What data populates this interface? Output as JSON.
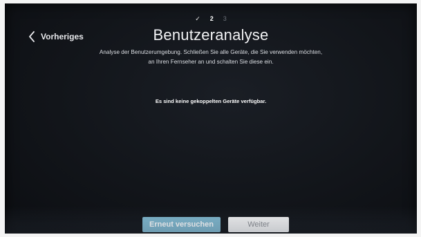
{
  "steps": {
    "step1": "✓",
    "step2": "2",
    "step3": "3"
  },
  "header": {
    "back_label": "Vorheriges",
    "title": "Benutzeranalyse"
  },
  "description": {
    "line1": "Analyse der Benutzerumgebung. Schließen Sie alle Geräte, die Sie verwenden möchten,",
    "line2": "an Ihren Fernseher an und schalten Sie diese ein."
  },
  "status_message": "Es sind keine gekoppelten Geräte verfügbar.",
  "buttons": {
    "retry_label": "Erneut versuchen",
    "next_label": "Weiter"
  },
  "colors": {
    "retry_button": "#7fb8cf",
    "next_button": "#f3f3f3",
    "screen_bg": "#12151a"
  }
}
